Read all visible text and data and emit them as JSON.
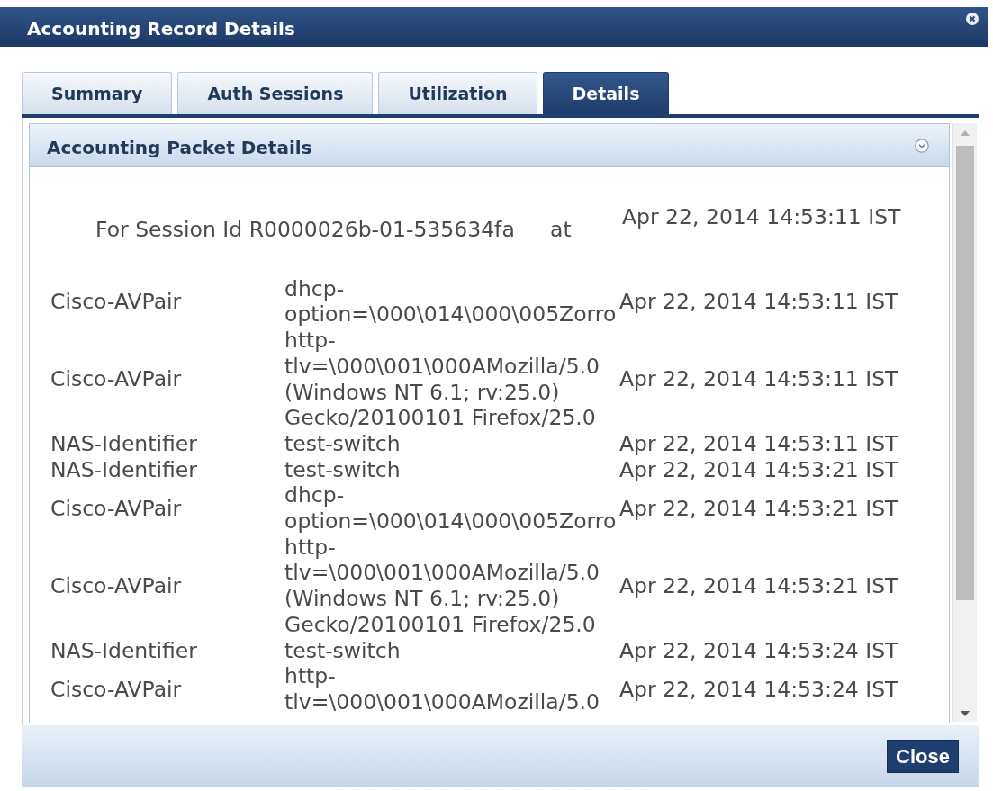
{
  "window": {
    "title": "Accounting Record Details"
  },
  "tabs": [
    {
      "label": "Summary",
      "selected": false
    },
    {
      "label": "Auth Sessions",
      "selected": false
    },
    {
      "label": "Utilization",
      "selected": false
    },
    {
      "label": "Details",
      "selected": true
    }
  ],
  "panel": {
    "title": "Accounting Packet Details"
  },
  "session": {
    "label": "For Session Id R0000026b-01-535634fa",
    "connector": "at",
    "time": "Apr 22, 2014 14:53:11 IST"
  },
  "attributes": [
    {
      "name": "Cisco-AVPair",
      "value": "dhcp-option=\\000\\014\\000\\005Zorro",
      "time": "Apr 22, 2014 14:53:11 IST"
    },
    {
      "name": "Cisco-AVPair",
      "value": "http-tlv=\\000\\001\\000AMozilla/5.0 (Windows NT 6.1; rv:25.0) Gecko/20100101 Firefox/25.0",
      "time": "Apr 22, 2014 14:53:11 IST"
    },
    {
      "name": "NAS-Identifier",
      "value": "test-switch",
      "time": "Apr 22, 2014 14:53:11 IST"
    },
    {
      "name": "NAS-Identifier",
      "value": "test-switch",
      "time": "Apr 22, 2014 14:53:21 IST"
    },
    {
      "name": "Cisco-AVPair",
      "value": "dhcp-option=\\000\\014\\000\\005Zorro",
      "time": "Apr 22, 2014 14:53:21 IST"
    },
    {
      "name": "Cisco-AVPair",
      "value": "http-tlv=\\000\\001\\000AMozilla/5.0 (Windows NT 6.1; rv:25.0) Gecko/20100101 Firefox/25.0",
      "time": "Apr 22, 2014 14:53:21 IST"
    },
    {
      "name": "NAS-Identifier",
      "value": "test-switch",
      "time": "Apr 22, 2014 14:53:24 IST"
    },
    {
      "name": "Cisco-AVPair",
      "value": "http-tlv=\\000\\001\\000AMozilla/5.0",
      "time": "Apr 22, 2014 14:53:24 IST"
    }
  ],
  "footer": {
    "close_button": "Close"
  }
}
